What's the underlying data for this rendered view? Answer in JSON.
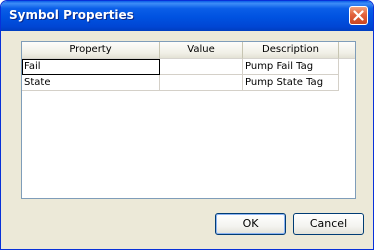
{
  "window": {
    "title": "Symbol Properties"
  },
  "table": {
    "columns": [
      "Property",
      "Value",
      "Description"
    ],
    "rows": [
      {
        "property": "Fail",
        "value": "",
        "description": "Pump Fail Tag"
      },
      {
        "property": "State",
        "value": "",
        "description": "Pump State Tag"
      }
    ]
  },
  "buttons": {
    "ok_label": "OK",
    "cancel_label": "Cancel"
  },
  "colors": {
    "titlebar": "#0054e3",
    "close_button": "#e2623d",
    "dialog_face": "#ece9d8"
  }
}
